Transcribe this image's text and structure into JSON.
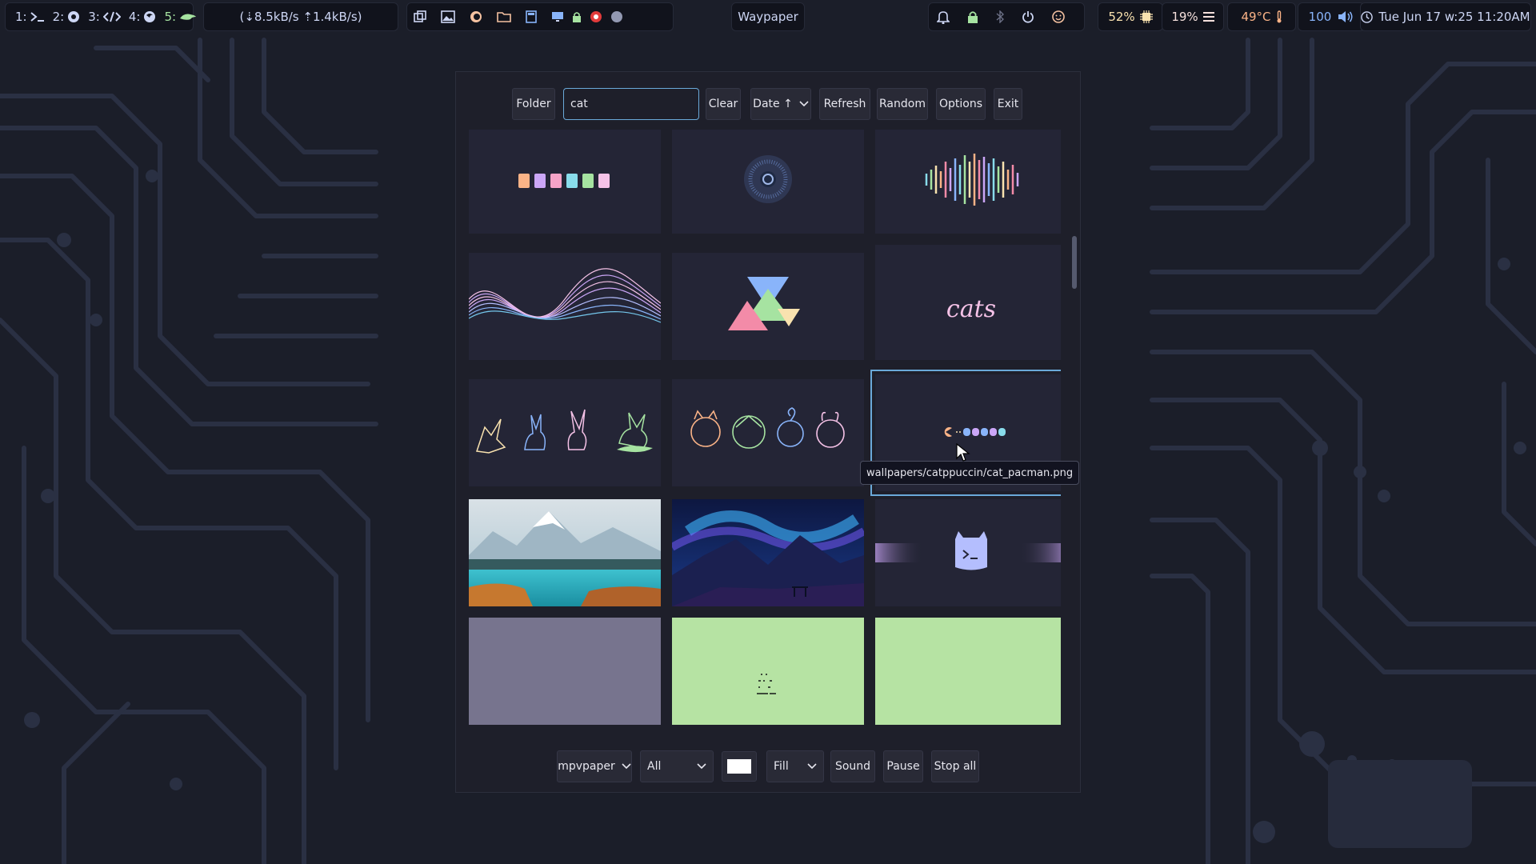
{
  "topbar": {
    "workspaces": [
      {
        "num": "1:",
        "icon": "terminal-icon"
      },
      {
        "num": "2:",
        "icon": "chromium-icon"
      },
      {
        "num": "3:",
        "icon": "code-icon"
      },
      {
        "num": "4:",
        "icon": "firefox-icon"
      },
      {
        "num": "5:",
        "icon": "lizard-icon"
      }
    ],
    "network": "(⇣8.5kB/s ⇡1.4kB/s)",
    "window_title": "Waypaper",
    "cpu": "52%",
    "memory": "19%",
    "temperature": "49°C",
    "volume": "100",
    "clock": "Tue Jun 17 w:25 11:20AM"
  },
  "window": {
    "toolbar": {
      "folder": "Folder",
      "search_value": "cat",
      "clear": "Clear",
      "sort": "Date ↑",
      "refresh": "Refresh",
      "random": "Random",
      "options": "Options",
      "exit": "Exit"
    },
    "thumbnails": [
      {
        "name": "catppuccin-palette"
      },
      {
        "name": "radial-circle"
      },
      {
        "name": "sound-wave"
      },
      {
        "name": "wavy-lines"
      },
      {
        "name": "triangles"
      },
      {
        "name": "cats-text",
        "text": "cats"
      },
      {
        "name": "pokemon-outlines"
      },
      {
        "name": "pokemon-heads"
      },
      {
        "name": "cat-pacman"
      },
      {
        "name": "mountain-lake"
      },
      {
        "name": "aurora-mountains"
      },
      {
        "name": "terminal-cat"
      },
      {
        "name": "gray-solid"
      },
      {
        "name": "green-ascii-cat"
      },
      {
        "name": "green-solid"
      }
    ],
    "tooltip": "wallpapers/catppuccin/cat_pacman.png",
    "bottom": {
      "backend": "mpvpaper",
      "monitor": "All",
      "fill": "Fill",
      "sound": "Sound",
      "pause": "Pause",
      "stop_all": "Stop all"
    }
  },
  "colors": {
    "accent": "#6aa9d9",
    "base": "#1e1f2a",
    "surface": "#292a36",
    "green": "#b6e3a3",
    "gray": "#77748e"
  }
}
